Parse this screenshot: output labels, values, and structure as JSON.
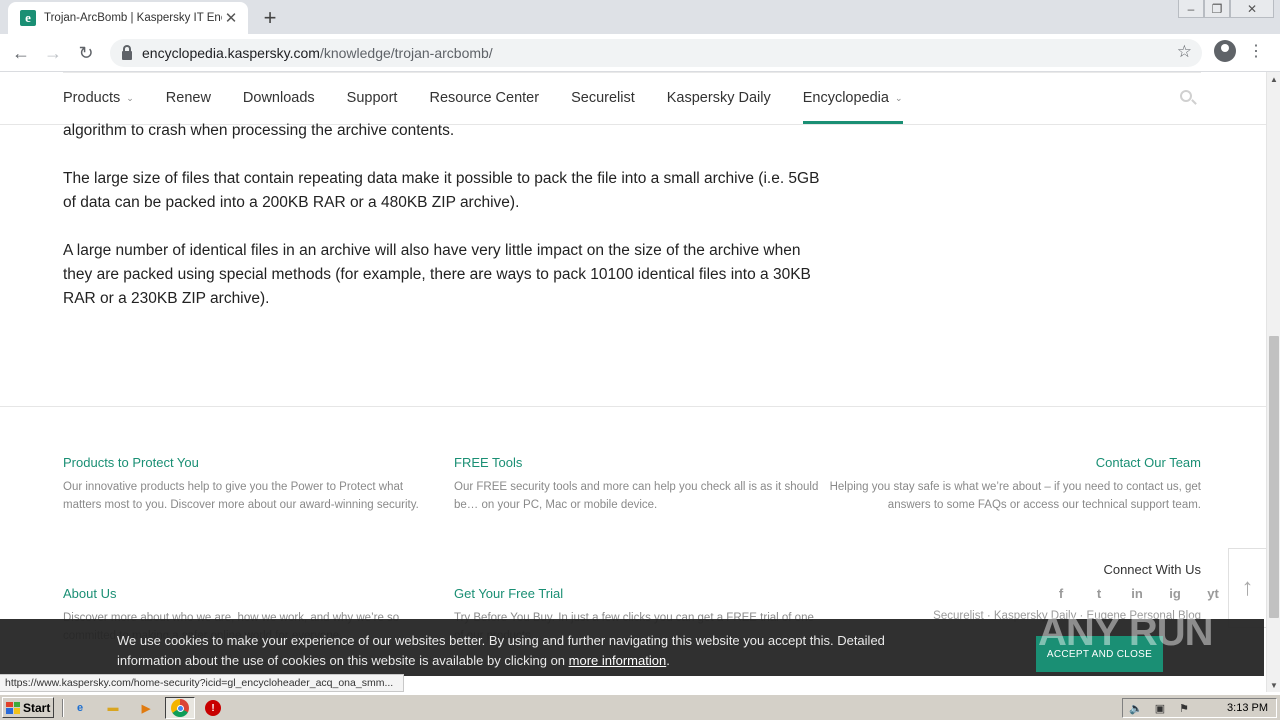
{
  "browser": {
    "tab_title": "Trojan-ArcBomb | Kaspersky IT Ency",
    "tab_favicon": "e",
    "url_domain": "encyclopedia.kaspersky.com",
    "url_path": "/knowledge/trojan-arcbomb/"
  },
  "nav": {
    "items": [
      {
        "label": "Products",
        "dropdown": true
      },
      {
        "label": "Renew"
      },
      {
        "label": "Downloads"
      },
      {
        "label": "Support"
      },
      {
        "label": "Resource Center"
      },
      {
        "label": "Securelist"
      },
      {
        "label": "Kaspersky Daily"
      },
      {
        "label": "Encyclopedia",
        "dropdown": true,
        "active": true
      }
    ],
    "accent_color": "#1a8f74"
  },
  "article": {
    "paragraphs": [
      "algorithm to crash when processing the archive contents.",
      "The large size of files that contain repeating data make it possible to pack the file into a small archive (i.e. 5GB of data can be packed into a 200KB RAR or a 480KB ZIP archive).",
      "A large number of identical files in an archive will also have very little impact on the size of the archive when they are packed using special methods (for example, there are ways to pack 10100 identical files into a 30KB RAR or a 230KB ZIP archive)."
    ]
  },
  "footer": {
    "products": {
      "title": "Products to Protect You",
      "text": "Our innovative products help to give you the Power to Protect what matters most to you. Discover more about our award-winning security."
    },
    "tools": {
      "title": "FREE Tools",
      "text": "Our FREE security tools and more can help you check all is as it should be… on your PC, Mac or mobile device."
    },
    "contact": {
      "title": "Contact Our Team",
      "text": "Helping you stay safe is what we’re about – if you need to contact us, get answers to some FAQs or access our technical support team."
    },
    "about": {
      "title": "About Us",
      "text": "Discover more about who we are, how we work, and why we’re so committed to making a safer online world for everyone."
    },
    "trial": {
      "title": "Get Your Free Trial",
      "text": "Try Before You Buy. In just a few clicks you can get a FREE trial of one of our products."
    },
    "connect_title": "Connect With Us",
    "social": [
      "f",
      "t",
      "in",
      "ig",
      "yt"
    ],
    "blog_links": "Securelist  ·  Kaspersky Daily  ·  Eugene Personal Blog"
  },
  "cookie": {
    "text": "We use cookies to make your experience of our websites better. By using and further navigating this website you accept this. Detailed information about the use of cookies on this website is available by clicking on ",
    "link": "more information",
    "after_link": ".",
    "button": "ACCEPT AND CLOSE"
  },
  "status_url": "https://www.kaspersky.com/home-security?icid=gl_encycloheader_acq_ona_smm...",
  "watermark": "ANY RUN",
  "taskbar": {
    "start_label": "Start",
    "clock": "3:13 PM"
  }
}
